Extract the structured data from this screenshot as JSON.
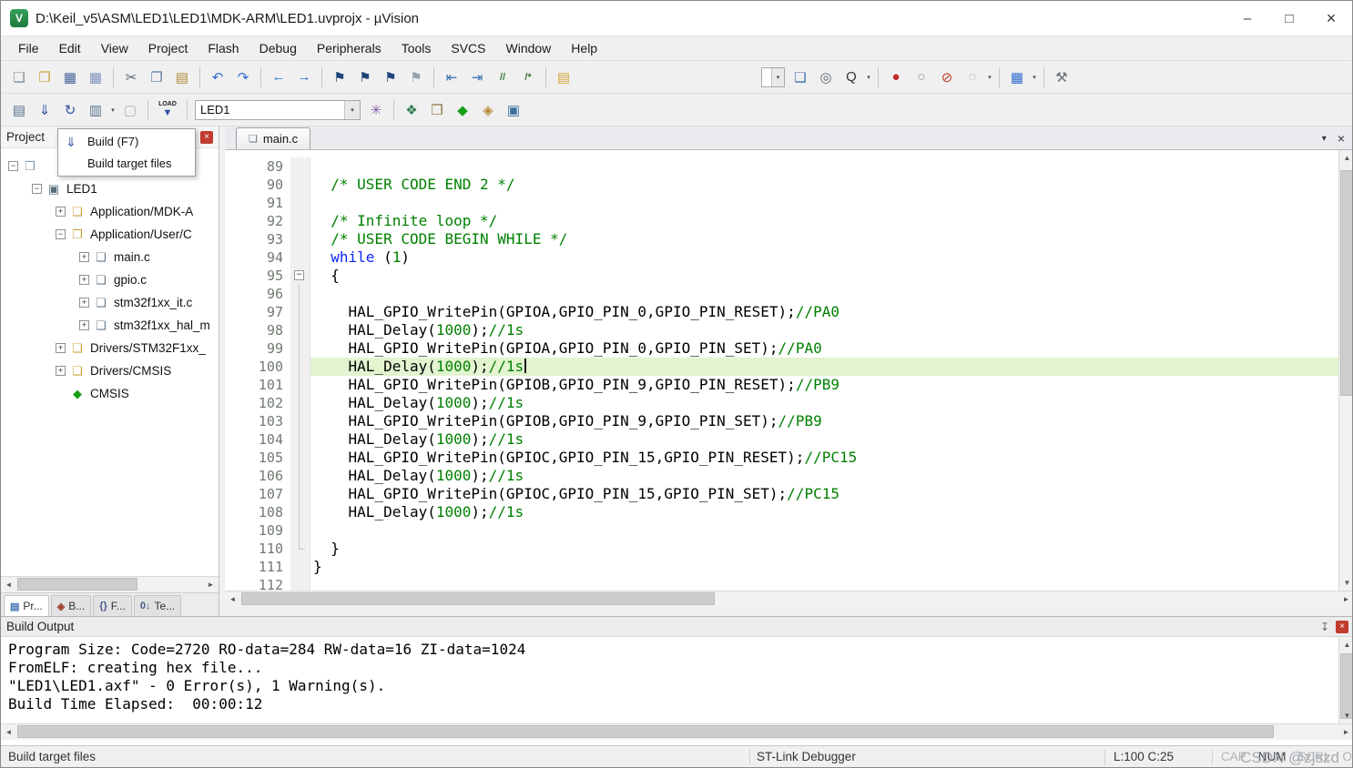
{
  "window": {
    "title": "D:\\Keil_v5\\ASM\\LED1\\LED1\\MDK-ARM\\LED1.uvprojx - µVision",
    "logo": "V"
  },
  "icons": {
    "minimize": "–",
    "maximize": "□",
    "close": "×",
    "pin": "↧",
    "dropdown": "▾",
    "scroll_up": "▲",
    "scroll_down": "▼",
    "scroll_left": "◄",
    "scroll_right": "►",
    "expand_plus": "+",
    "expand_minus": "−",
    "fold_collapse": "−",
    "file_tab": "❏",
    "build_glyph": "⇓"
  },
  "menu": {
    "items": [
      "File",
      "Edit",
      "View",
      "Project",
      "Flash",
      "Debug",
      "Peripherals",
      "Tools",
      "SVCS",
      "Window",
      "Help"
    ]
  },
  "toolbar_main": {
    "items": [
      {
        "name": "new-file-icon",
        "g": "❏",
        "c": "#7d8a97"
      },
      {
        "name": "open-file-icon",
        "g": "❐",
        "c": "#c9a13b"
      },
      {
        "name": "save-icon",
        "g": "▦",
        "c": "#46669c"
      },
      {
        "name": "save-all-icon",
        "g": "▦",
        "c": "#7d93bd"
      },
      {
        "sep": true
      },
      {
        "name": "cut-icon",
        "g": "✂",
        "c": "#5a6570"
      },
      {
        "name": "copy-icon",
        "g": "❐",
        "c": "#5a7a9a"
      },
      {
        "name": "paste-icon",
        "g": "▤",
        "c": "#b08d3e"
      },
      {
        "sep": true
      },
      {
        "name": "undo-icon",
        "g": "↶",
        "c": "#2f6fd0"
      },
      {
        "name": "redo-icon",
        "g": "↷",
        "c": "#2f6fd0"
      },
      {
        "sep": true
      },
      {
        "name": "navigate-back-icon",
        "g": "←",
        "c": "#2f6fd0"
      },
      {
        "name": "navigate-forward-icon",
        "g": "→",
        "c": "#2f6fd0"
      },
      {
        "sep": true
      },
      {
        "name": "bookmark-toggle-icon",
        "g": "⚑",
        "c": "#1d4379"
      },
      {
        "name": "bookmark-prev-icon",
        "g": "⚑",
        "c": "#1d4379"
      },
      {
        "name": "bookmark-next-icon",
        "g": "⚑",
        "c": "#1d4379"
      },
      {
        "name": "bookmark-clear-icon",
        "g": "⚑",
        "c": "#97a1ab"
      },
      {
        "sep": true
      },
      {
        "name": "outdent-icon",
        "g": "⇤",
        "c": "#3a6fb0"
      },
      {
        "name": "indent-icon",
        "g": "⇥",
        "c": "#3a6fb0"
      },
      {
        "name": "comment-icon",
        "g": "//",
        "c": "#3d7a3d",
        "small": true
      },
      {
        "name": "uncomment-icon",
        "g": "/*",
        "c": "#3d7a3d",
        "small": true
      },
      {
        "sep": true
      },
      {
        "name": "insert-template-icon",
        "g": "▤",
        "c": "#d2a93a"
      },
      {
        "gap": 200
      },
      {
        "combo": true,
        "name": "find-history-combo",
        "value": "",
        "width": 26
      },
      {
        "name": "find-in-files-icon",
        "g": "❏",
        "c": "#3a6fb0"
      },
      {
        "name": "find-icon",
        "g": "◎",
        "c": "#5a6570"
      },
      {
        "name": "quick-find-icon",
        "g": "Q",
        "c": "#333333",
        "dd": true
      },
      {
        "sep": true
      },
      {
        "name": "insert-breakpoint-icon",
        "g": "●",
        "c": "#c62828"
      },
      {
        "name": "disable-breakpoint-icon",
        "g": "○",
        "c": "#8d969f"
      },
      {
        "name": "kill-breakpoints-icon",
        "g": "⊘",
        "c": "#c0392b"
      },
      {
        "name": "breakpoint-options-icon",
        "g": "◌",
        "c": "#8d969f",
        "dd": true
      },
      {
        "sep": true
      },
      {
        "name": "window-layout-icon",
        "g": "▦",
        "c": "#2f6fd0",
        "dd": true
      },
      {
        "sep": true
      },
      {
        "name": "configure-icon",
        "g": "⚒",
        "c": "#6a7077"
      }
    ]
  },
  "toolbar_build": {
    "items": [
      {
        "name": "translate-icon",
        "g": "▤",
        "c": "#57728c"
      },
      {
        "name": "build-icon",
        "g": "⇓",
        "c": "#2f4fa0"
      },
      {
        "name": "rebuild-icon",
        "g": "↻",
        "c": "#2f4fa0"
      },
      {
        "name": "batch-build-icon",
        "g": "▥",
        "c": "#57728c",
        "dd": true
      },
      {
        "name": "stop-build-icon",
        "g": "▢",
        "c": "#aab2ba"
      },
      {
        "sep": true
      },
      {
        "name": "download-icon",
        "load": true,
        "label": "LOAD"
      },
      {
        "sep": true
      },
      {
        "combo": true,
        "name": "target-select",
        "value": "LED1",
        "width": 182
      },
      {
        "name": "target-options-icon",
        "g": "✳",
        "c": "#8a5fae"
      },
      {
        "sep": true
      },
      {
        "name": "manage-project-items-icon",
        "g": "❖",
        "c": "#2e7d52"
      },
      {
        "name": "file-extensions-icon",
        "g": "❒",
        "c": "#8a7340"
      },
      {
        "name": "runtime-environment-icon",
        "g": "◆",
        "c": "#17a017"
      },
      {
        "name": "select-packs-icon",
        "g": "◈",
        "c": "#b8862f"
      },
      {
        "name": "pack-installer-icon",
        "g": "▣",
        "c": "#3a6fa0"
      }
    ]
  },
  "tooltip": {
    "title": "Build (F7)",
    "subtitle": "Build target files"
  },
  "project_panel": {
    "title": "Project",
    "tree_icons": {
      "workspace": {
        "g": "❒",
        "c": "#7d98ad"
      },
      "target": {
        "g": "▣",
        "c": "#5a6f7d"
      },
      "folder": {
        "g": "❑",
        "c": "#c9a13b"
      },
      "folder-open": {
        "g": "❐",
        "c": "#c9a13b"
      },
      "file": {
        "g": "❏",
        "c": "#6a7a8a"
      },
      "diamond": {
        "g": "◆",
        "c": "#17a017"
      }
    },
    "tree": [
      {
        "label": "",
        "icon": "workspace",
        "level": 0,
        "exp": "minus"
      },
      {
        "label": "LED1",
        "icon": "target",
        "level": 1,
        "exp": "minus"
      },
      {
        "label": "Application/MDK-A",
        "icon": "folder",
        "level": 2,
        "exp": "plus"
      },
      {
        "label": "Application/User/C",
        "icon": "folder-open",
        "level": 2,
        "exp": "minus"
      },
      {
        "label": "main.c",
        "icon": "file",
        "level": 3,
        "exp": "plus"
      },
      {
        "label": "gpio.c",
        "icon": "file",
        "level": 3,
        "exp": "plus"
      },
      {
        "label": "stm32f1xx_it.c",
        "icon": "file",
        "level": 3,
        "exp": "plus"
      },
      {
        "label": "stm32f1xx_hal_m",
        "icon": "file",
        "level": 3,
        "exp": "plus"
      },
      {
        "label": "Drivers/STM32F1xx_",
        "icon": "folder",
        "level": 2,
        "exp": "plus"
      },
      {
        "label": "Drivers/CMSIS",
        "icon": "folder",
        "level": 2,
        "exp": "plus"
      },
      {
        "label": "CMSIS",
        "icon": "diamond",
        "level": 2,
        "exp": "none"
      }
    ],
    "tabs": [
      {
        "name": "tab-project",
        "label": "Pr...",
        "icon": "▤",
        "ic": "#3a6fb0",
        "active": true
      },
      {
        "name": "tab-books",
        "label": "B...",
        "icon": "◈",
        "ic": "#a04030",
        "active": false
      },
      {
        "name": "tab-functions",
        "label": "F...",
        "icon": "{}",
        "ic": "#445a8a",
        "active": false
      },
      {
        "name": "tab-templates",
        "label": "Te...",
        "icon": "0↓",
        "ic": "#445a8a",
        "active": false
      }
    ]
  },
  "editor": {
    "tab": "main.c",
    "lines": [
      {
        "no": "89",
        "s": []
      },
      {
        "no": "90",
        "s": [
          {
            "t": "  /* USER CODE END 2 */",
            "c": "c"
          }
        ]
      },
      {
        "no": "91",
        "s": []
      },
      {
        "no": "92",
        "s": [
          {
            "t": "  /* Infinite loop */",
            "c": "c"
          }
        ]
      },
      {
        "no": "93",
        "s": [
          {
            "t": "  /* USER CODE BEGIN WHILE */",
            "c": "c"
          }
        ]
      },
      {
        "no": "94",
        "s": [
          {
            "t": "  ",
            "c": "p"
          },
          {
            "t": "while",
            "c": "k"
          },
          {
            "t": " (",
            "c": "p"
          },
          {
            "t": "1",
            "c": "n"
          },
          {
            "t": ")",
            "c": "p"
          }
        ]
      },
      {
        "no": "95",
        "s": [
          {
            "t": "  {",
            "c": "p"
          }
        ],
        "fold": true
      },
      {
        "no": "96",
        "s": [],
        "fl": true
      },
      {
        "no": "97",
        "s": [
          {
            "t": "    HAL_GPIO_WritePin(GPIOA,GPIO_PIN_0,GPIO_PIN_RESET);",
            "c": "p"
          },
          {
            "t": "//PA0",
            "c": "c"
          }
        ],
        "fl": true
      },
      {
        "no": "98",
        "s": [
          {
            "t": "    HAL_Delay(",
            "c": "p"
          },
          {
            "t": "1000",
            "c": "n"
          },
          {
            "t": ");",
            "c": "p"
          },
          {
            "t": "//1s",
            "c": "c"
          }
        ],
        "fl": true
      },
      {
        "no": "99",
        "s": [
          {
            "t": "    HAL_GPIO_WritePin(GPIOA,GPIO_PIN_0,GPIO_PIN_SET);",
            "c": "p"
          },
          {
            "t": "//PA0",
            "c": "c"
          }
        ],
        "fl": true
      },
      {
        "no": "100",
        "s": [
          {
            "t": "    HAL_Delay(",
            "c": "p"
          },
          {
            "t": "1000",
            "c": "n"
          },
          {
            "t": ");",
            "c": "p"
          },
          {
            "t": "//1s",
            "c": "c"
          }
        ],
        "fl": true,
        "hl": true,
        "caret": true
      },
      {
        "no": "101",
        "s": [
          {
            "t": "    HAL_GPIO_WritePin(GPIOB,GPIO_PIN_9,GPIO_PIN_RESET);",
            "c": "p"
          },
          {
            "t": "//PB9",
            "c": "c"
          }
        ],
        "fl": true
      },
      {
        "no": "102",
        "s": [
          {
            "t": "    HAL_Delay(",
            "c": "p"
          },
          {
            "t": "1000",
            "c": "n"
          },
          {
            "t": ");",
            "c": "p"
          },
          {
            "t": "//1s",
            "c": "c"
          }
        ],
        "fl": true
      },
      {
        "no": "103",
        "s": [
          {
            "t": "    HAL_GPIO_WritePin(GPIOB,GPIO_PIN_9,GPIO_PIN_SET);",
            "c": "p"
          },
          {
            "t": "//PB9",
            "c": "c"
          }
        ],
        "fl": true
      },
      {
        "no": "104",
        "s": [
          {
            "t": "    HAL_Delay(",
            "c": "p"
          },
          {
            "t": "1000",
            "c": "n"
          },
          {
            "t": ");",
            "c": "p"
          },
          {
            "t": "//1s",
            "c": "c"
          }
        ],
        "fl": true
      },
      {
        "no": "105",
        "s": [
          {
            "t": "    HAL_GPIO_WritePin(GPIOC,GPIO_PIN_15,GPIO_PIN_RESET);",
            "c": "p"
          },
          {
            "t": "//PC15",
            "c": "c"
          }
        ],
        "fl": true
      },
      {
        "no": "106",
        "s": [
          {
            "t": "    HAL_Delay(",
            "c": "p"
          },
          {
            "t": "1000",
            "c": "n"
          },
          {
            "t": ");",
            "c": "p"
          },
          {
            "t": "//1s",
            "c": "c"
          }
        ],
        "fl": true
      },
      {
        "no": "107",
        "s": [
          {
            "t": "    HAL_GPIO_WritePin(GPIOC,GPIO_PIN_15,GPIO_PIN_SET);",
            "c": "p"
          },
          {
            "t": "//PC15",
            "c": "c"
          }
        ],
        "fl": true
      },
      {
        "no": "108",
        "s": [
          {
            "t": "    HAL_Delay(",
            "c": "p"
          },
          {
            "t": "1000",
            "c": "n"
          },
          {
            "t": ");",
            "c": "p"
          },
          {
            "t": "//1s",
            "c": "c"
          }
        ],
        "fl": true
      },
      {
        "no": "109",
        "s": [],
        "fl": true
      },
      {
        "no": "110",
        "s": [
          {
            "t": "  }",
            "c": "p"
          }
        ],
        "fe": true
      },
      {
        "no": "111",
        "s": [
          {
            "t": "}",
            "c": "p"
          }
        ]
      },
      {
        "no": "112",
        "s": []
      }
    ]
  },
  "build_output": {
    "title": "Build Output",
    "lines": [
      "Program Size: Code=2720 RO-data=284 RW-data=16 ZI-data=1024",
      "FromELF: creating hex file...",
      "\"LED1\\LED1.axf\" - 0 Error(s), 1 Warning(s).",
      "Build Time Elapsed:  00:00:12"
    ]
  },
  "status_bar": {
    "left": "Build target files",
    "debugger": "ST-Link Debugger",
    "position": "L:100 C:25",
    "flags": [
      {
        "t": "CAP",
        "on": false
      },
      {
        "t": "NUM",
        "on": true
      },
      {
        "t": "SCRL",
        "on": false
      },
      {
        "t": "OVR",
        "on": false
      }
    ]
  },
  "watermark": "CSDN @zjszd"
}
